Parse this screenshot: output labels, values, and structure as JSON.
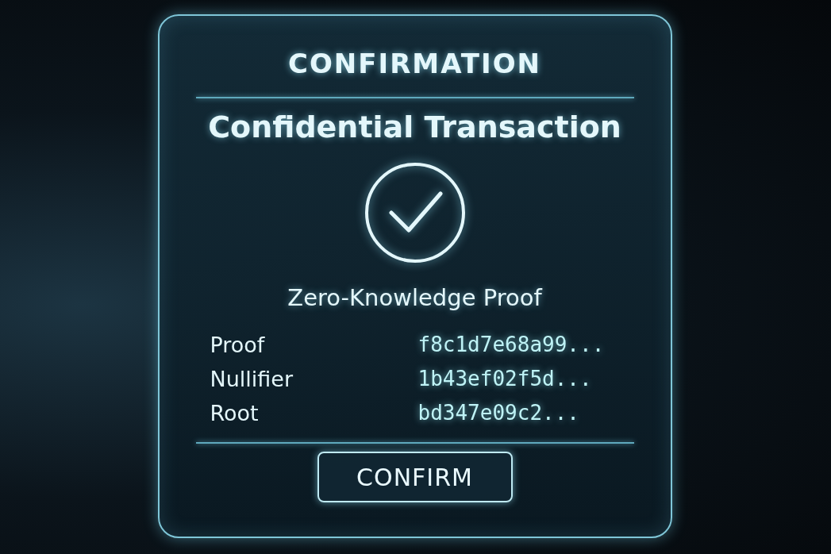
{
  "dialog": {
    "title": "CONFIRMATION",
    "heading": "Confidential Transaction",
    "subtitle": "Zero-Knowledge Proof",
    "fields": [
      {
        "label": "Proof",
        "value": "f8c1d7e68a99..."
      },
      {
        "label": "Nullifier",
        "value": "1b43ef02f5d..."
      },
      {
        "label": "Root",
        "value": "bd347e09c2..."
      }
    ],
    "button": "CONFIRM"
  }
}
